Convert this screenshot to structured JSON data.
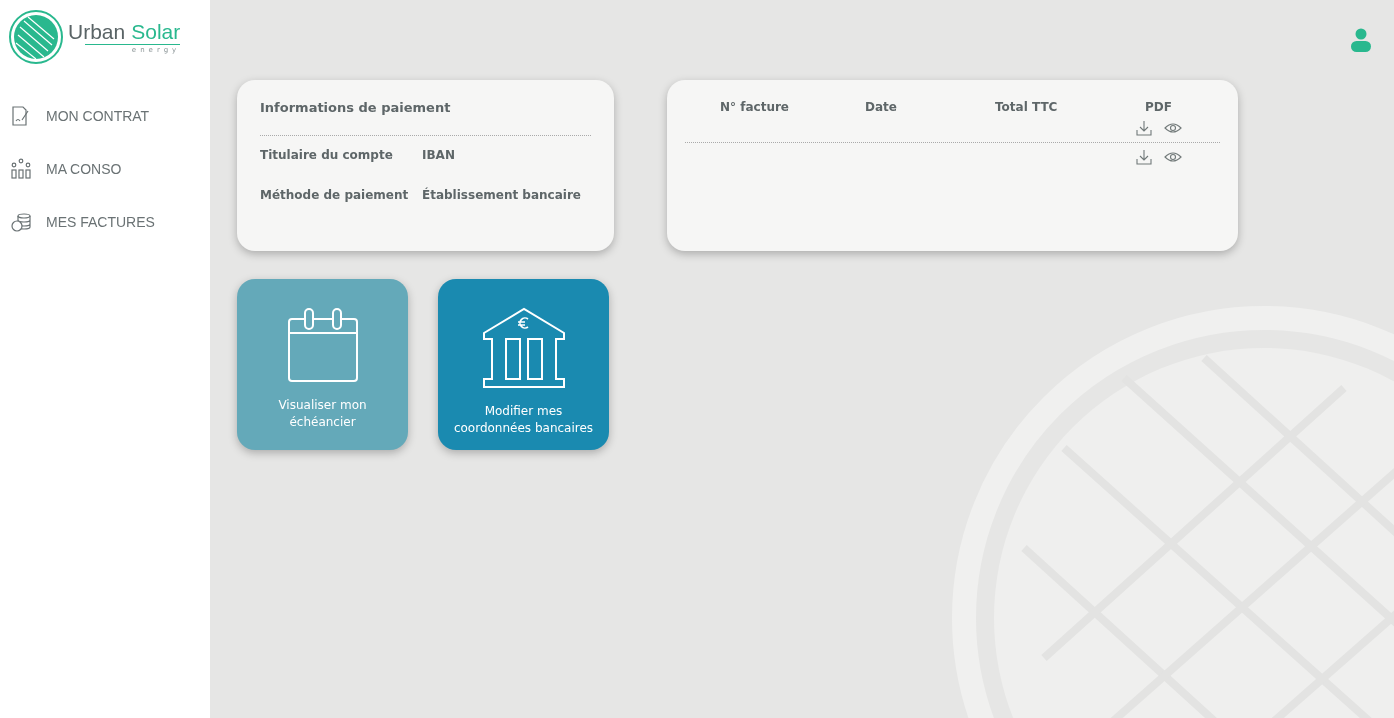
{
  "logo": {
    "brand_first": "Urban",
    "brand_second": "Solar",
    "tagline": "energy"
  },
  "sidebar": {
    "items": [
      {
        "label": "MON CONTRAT",
        "kind": "contract"
      },
      {
        "label": "MA CONSO",
        "kind": "usage"
      },
      {
        "label": "MES FACTURES",
        "kind": "invoices"
      }
    ]
  },
  "payment_card": {
    "title": "Informations de paiement",
    "rows": [
      {
        "label": "Titulaire du compte",
        "value": "IBAN"
      },
      {
        "label": "Méthode de paiement",
        "value": "Établissement bancaire"
      }
    ]
  },
  "invoice_table": {
    "columns": [
      "N° facture",
      "Date",
      "Total TTC",
      "PDF"
    ],
    "rows": [
      {
        "kind": "invoice"
      },
      {
        "kind": "invoice"
      }
    ]
  },
  "tiles": [
    {
      "label": "Visualiser mon échéancier",
      "kind": "calendar",
      "color": "#64a9b9"
    },
    {
      "label": "Modifier mes coordonnées bancaires",
      "kind": "bank",
      "color": "#1a8ab0"
    }
  ]
}
